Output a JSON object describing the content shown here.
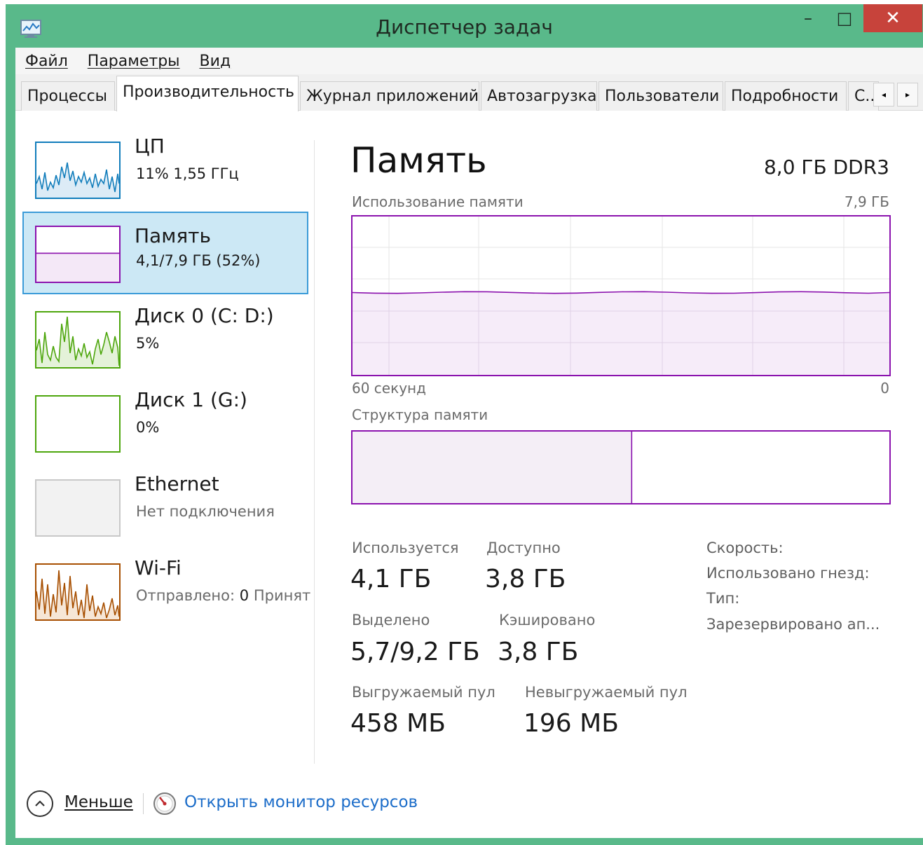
{
  "window": {
    "title": "Диспетчер задач",
    "minimize": "–",
    "maximize": "□",
    "close": "✕"
  },
  "colors": {
    "frame": "#59b98a",
    "cpu": "#117dbb",
    "memory": "#8b12ae",
    "disk": "#4da60c",
    "wifi": "#a74f01",
    "selection": "#cce8f5"
  },
  "menu": {
    "file": "Файл",
    "options": "Параметры",
    "view": "Вид"
  },
  "tabs": {
    "processes": "Процессы",
    "performance": "Производительность",
    "app_history": "Журнал приложений",
    "startup": "Автозагрузка",
    "users": "Пользователи",
    "details": "Подробности",
    "services": "С..",
    "scroll_left": "◂",
    "scroll_right": "▸"
  },
  "sidebar": {
    "cpu": {
      "title": "ЦП",
      "sub": "11%  1,55 ГГц"
    },
    "memory": {
      "title": "Память",
      "sub": "4,1/7,9 ГБ (52%)"
    },
    "disk0": {
      "title": "Диск 0 (C: D:)",
      "sub": "5%"
    },
    "disk1": {
      "title": "Диск 1 (G:)",
      "sub": "0%"
    },
    "ethernet": {
      "title": "Ethernet",
      "sub": "Нет подключения"
    },
    "wifi": {
      "title": "Wi-Fi",
      "sub_sent_label": "Отправлено:",
      "sub_sent_value": "0",
      "sub_recv_label": "Принят"
    }
  },
  "detail": {
    "title": "Память",
    "mem_type": "8,0 ГБ DDR3",
    "usage_label": "Использование памяти",
    "usage_max": "7,9 ГБ",
    "time_left": "60 секунд",
    "time_right": "0",
    "composition_label": "Структура памяти",
    "usage_fraction": 0.52,
    "composition_in_use_fraction": 0.52
  },
  "stats": {
    "in_use_label": "Используется",
    "in_use": "4,1 ГБ",
    "available_label": "Доступно",
    "available": "3,8 ГБ",
    "committed_label": "Выделено",
    "committed": "5,7/9,2 ГБ",
    "cached_label": "Кэшировано",
    "cached": "3,8 ГБ",
    "paged_label": "Выгружаемый пул",
    "paged": "458 МБ",
    "nonpaged_label": "Невыгружаемый пул",
    "nonpaged": "196 МБ",
    "speed_label": "Скорость:",
    "slots_label": "Использовано гнезд:",
    "form_label": "Тип:",
    "reserved_label": "Зарезервировано ап..."
  },
  "footer": {
    "fewer": "Меньше",
    "resmon": "Открыть монитор ресурсов"
  }
}
